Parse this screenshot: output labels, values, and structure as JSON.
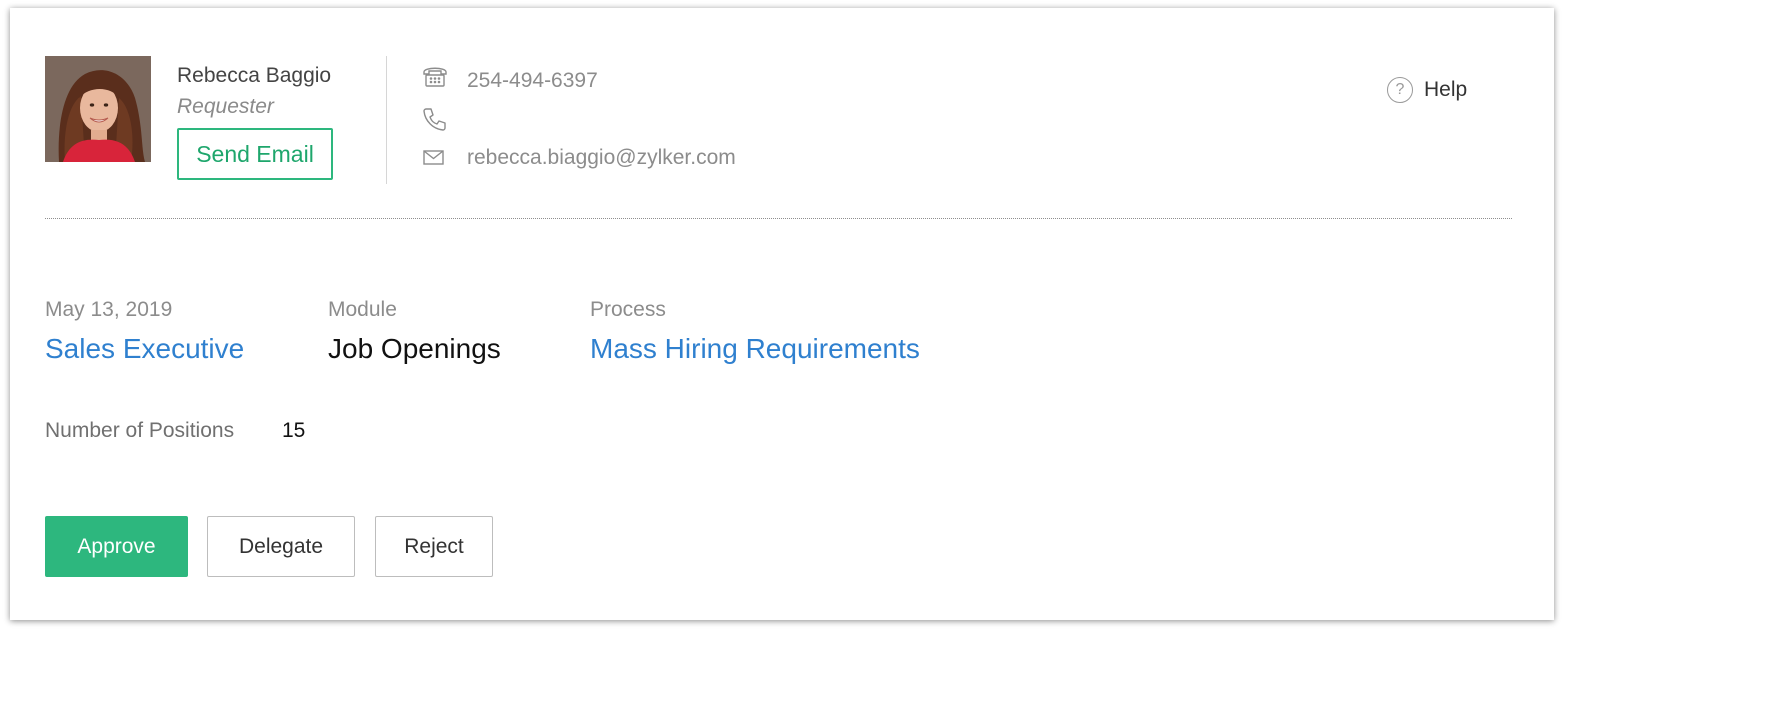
{
  "requester": {
    "name": "Rebecca Baggio",
    "role": "Requester",
    "send_email_label": "Send Email",
    "avatar_icon": "avatar-photo"
  },
  "contact": {
    "phone": "254-494-6397",
    "mobile": "",
    "email": "rebecca.biaggio@zylker.com",
    "phone_icon": "telephone-icon",
    "mobile_icon": "handset-icon",
    "email_icon": "envelope-icon"
  },
  "help": {
    "label": "Help",
    "icon_glyph": "?"
  },
  "record": {
    "date": "May 13, 2019",
    "title": "Sales Executive",
    "module_label": "Module",
    "module_value": "Job Openings",
    "process_label": "Process",
    "process_value": "Mass Hiring Requirements"
  },
  "positions": {
    "label": "Number of Positions",
    "value": "15"
  },
  "actions": {
    "approve": "Approve",
    "delegate": "Delegate",
    "reject": "Reject"
  },
  "colors": {
    "accent_green": "#2db77e",
    "link_blue": "#2f80cf",
    "muted_text": "#8c8c8c"
  }
}
